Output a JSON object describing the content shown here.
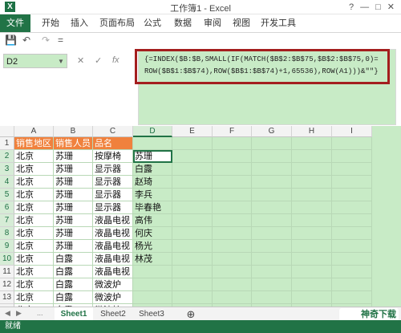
{
  "window": {
    "title": "工作簿1 - Excel",
    "app_icon": "X",
    "help": "?",
    "minimize": "—",
    "maximize": "□",
    "close": "✕"
  },
  "ribbon": {
    "tabs": [
      "文件",
      "开始",
      "插入",
      "页面布局",
      "公式",
      "数据",
      "审阅",
      "视图",
      "开发工具"
    ]
  },
  "qat": {
    "save_icon": "💾",
    "undo_icon": "↶",
    "redo_icon": "↷",
    "more_icon": "="
  },
  "formula_bar": {
    "name_box": "D2",
    "cancel": "✕",
    "enter": "✓",
    "fx": "fx",
    "formula_line1": "{=INDEX($B:$B,SMALL(IF(MATCH($B$2:$B$75,$B$2:$B$75,0)=",
    "formula_line2": "ROW($B$1:$B$74),ROW($B$1:$B$74)+1,65536),ROW(A1)))&\"\"}"
  },
  "columns": [
    "A",
    "B",
    "C",
    "D",
    "E",
    "F",
    "G",
    "H",
    "I"
  ],
  "selected_column": "D",
  "rows": [
    {
      "n": "1",
      "a": "销售地区",
      "b": "销售人员",
      "c": "品名",
      "d": ""
    },
    {
      "n": "2",
      "a": "北京",
      "b": "苏珊",
      "c": "按摩椅",
      "d": "苏珊"
    },
    {
      "n": "3",
      "a": "北京",
      "b": "苏珊",
      "c": "显示器",
      "d": "白露"
    },
    {
      "n": "4",
      "a": "北京",
      "b": "苏珊",
      "c": "显示器",
      "d": "赵琦"
    },
    {
      "n": "5",
      "a": "北京",
      "b": "苏珊",
      "c": "显示器",
      "d": "李兵"
    },
    {
      "n": "6",
      "a": "北京",
      "b": "苏珊",
      "c": "显示器",
      "d": "毕春艳"
    },
    {
      "n": "7",
      "a": "北京",
      "b": "苏珊",
      "c": "液晶电视",
      "d": "高伟"
    },
    {
      "n": "8",
      "a": "北京",
      "b": "苏珊",
      "c": "液晶电视",
      "d": "何庆"
    },
    {
      "n": "9",
      "a": "北京",
      "b": "苏珊",
      "c": "液晶电视",
      "d": "杨光"
    },
    {
      "n": "10",
      "a": "北京",
      "b": "白露",
      "c": "液晶电视",
      "d": "林茂"
    },
    {
      "n": "11",
      "a": "北京",
      "b": "白露",
      "c": "液晶电视",
      "d": ""
    },
    {
      "n": "12",
      "a": "北京",
      "b": "白露",
      "c": "微波炉",
      "d": ""
    },
    {
      "n": "13",
      "a": "北京",
      "b": "白露",
      "c": "微波炉",
      "d": ""
    },
    {
      "n": "14",
      "a": "北京",
      "b": "白露",
      "c": "微波炉",
      "d": ""
    },
    {
      "n": "15",
      "a": "北京",
      "b": "白露",
      "c": "按摩椅",
      "d": ""
    }
  ],
  "sheets": {
    "tabs": [
      "Sheet1",
      "Sheet2",
      "Sheet3"
    ],
    "add": "⊕",
    "prev": "◀",
    "next": "▶",
    "more": "..."
  },
  "status": {
    "ready": "就绪"
  },
  "watermark": "神奇下载",
  "colors": {
    "excel_green": "#217346",
    "header_orange": "#f0813d",
    "selection_green": "#c8ebc6",
    "highlight_red": "#a41e1e"
  }
}
